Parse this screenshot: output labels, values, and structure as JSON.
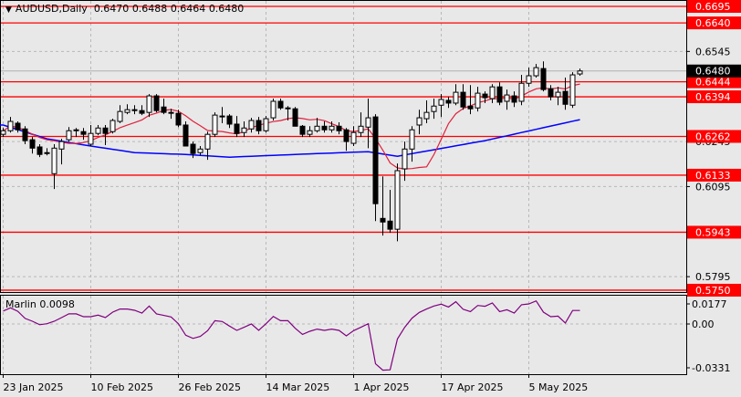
{
  "header": {
    "symbol": "AUDUSD,Daily",
    "open": "0.6470",
    "high": "0.6488",
    "low": "0.6464",
    "close": "0.6480"
  },
  "indicator": {
    "name": "Marlin",
    "value": "0.0098"
  },
  "colors": {
    "background": "#e8e8e8",
    "level": "#ff0000",
    "ma_fast": "#e0203c",
    "ma_slow": "#0000ff",
    "oscillator": "#800080",
    "bid_label": "#000000"
  },
  "chart_data": {
    "type": "candlestick",
    "symbol": "AUDUSD",
    "timeframe": "Daily",
    "ylim": [
      0.5733,
      0.6717
    ],
    "price_ticks": [
      "0.6545",
      "0.6245",
      "0.6095",
      "0.5795"
    ],
    "current_price": "0.6480",
    "levels": [
      "0.6695",
      "0.6640",
      "0.6444",
      "0.6394",
      "0.6262",
      "0.6133",
      "0.5943",
      "0.5750"
    ],
    "x_labels": [
      {
        "index": 0,
        "label": "23 Jan 2025"
      },
      {
        "index": 12,
        "label": "10 Feb 2025"
      },
      {
        "index": 24,
        "label": "26 Feb 2025"
      },
      {
        "index": 36,
        "label": "14 Mar 2025"
      },
      {
        "index": 48,
        "label": "1 Apr 2025"
      },
      {
        "index": 60,
        "label": "17 Apr 2025"
      },
      {
        "index": 72,
        "label": "5 May 2025"
      }
    ],
    "ohlc": [
      [
        0.6269,
        0.629,
        0.626,
        0.6281
      ],
      [
        0.6281,
        0.6327,
        0.6275,
        0.6312
      ],
      [
        0.6306,
        0.6312,
        0.6275,
        0.6284
      ],
      [
        0.6287,
        0.6296,
        0.6236,
        0.6248
      ],
      [
        0.6251,
        0.626,
        0.6205,
        0.6223
      ],
      [
        0.6227,
        0.6236,
        0.6193,
        0.6202
      ],
      [
        0.6208,
        0.6223,
        0.6199,
        0.6205
      ],
      [
        0.6138,
        0.6236,
        0.6087,
        0.6223
      ],
      [
        0.622,
        0.6254,
        0.6169,
        0.6245
      ],
      [
        0.6251,
        0.6293,
        0.6245,
        0.6281
      ],
      [
        0.6281,
        0.629,
        0.626,
        0.6284
      ],
      [
        0.6278,
        0.629,
        0.6251,
        0.6269
      ],
      [
        0.6236,
        0.63,
        0.623,
        0.6272
      ],
      [
        0.6272,
        0.63,
        0.6266,
        0.629
      ],
      [
        0.629,
        0.63,
        0.6233,
        0.6272
      ],
      [
        0.6278,
        0.6321,
        0.6272,
        0.6315
      ],
      [
        0.6312,
        0.6366,
        0.6306,
        0.6345
      ],
      [
        0.6342,
        0.6369,
        0.6336,
        0.6351
      ],
      [
        0.6348,
        0.6366,
        0.6336,
        0.6351
      ],
      [
        0.6348,
        0.6366,
        0.6333,
        0.6339
      ],
      [
        0.6342,
        0.6403,
        0.6327,
        0.6397
      ],
      [
        0.6397,
        0.6403,
        0.6342,
        0.6348
      ],
      [
        0.636,
        0.6388,
        0.6336,
        0.6342
      ],
      [
        0.6342,
        0.6354,
        0.6321,
        0.6339
      ],
      [
        0.6339,
        0.6351,
        0.6293,
        0.63
      ],
      [
        0.63,
        0.6312,
        0.623,
        0.623
      ],
      [
        0.6236,
        0.6245,
        0.619,
        0.6205
      ],
      [
        0.6208,
        0.623,
        0.6199,
        0.622
      ],
      [
        0.622,
        0.6278,
        0.6184,
        0.6269
      ],
      [
        0.6269,
        0.6342,
        0.626,
        0.6333
      ],
      [
        0.6327,
        0.636,
        0.6306,
        0.633
      ],
      [
        0.633,
        0.6336,
        0.629,
        0.6303
      ],
      [
        0.6303,
        0.633,
        0.626,
        0.6272
      ],
      [
        0.6275,
        0.6312,
        0.626,
        0.629
      ],
      [
        0.6287,
        0.6324,
        0.6275,
        0.6315
      ],
      [
        0.6315,
        0.6327,
        0.6269,
        0.6281
      ],
      [
        0.6281,
        0.633,
        0.6275,
        0.6321
      ],
      [
        0.6324,
        0.6388,
        0.6315,
        0.6379
      ],
      [
        0.6379,
        0.6388,
        0.6351,
        0.6357
      ],
      [
        0.6357,
        0.6363,
        0.6315,
        0.6354
      ],
      [
        0.6354,
        0.636,
        0.6296,
        0.6296
      ],
      [
        0.6296,
        0.63,
        0.626,
        0.6269
      ],
      [
        0.6269,
        0.6296,
        0.626,
        0.6281
      ],
      [
        0.6281,
        0.6324,
        0.6275,
        0.6296
      ],
      [
        0.6296,
        0.6312,
        0.6275,
        0.6284
      ],
      [
        0.6284,
        0.6312,
        0.6275,
        0.6296
      ],
      [
        0.6296,
        0.6309,
        0.6269,
        0.6281
      ],
      [
        0.6284,
        0.629,
        0.6214,
        0.6245
      ],
      [
        0.6239,
        0.6296,
        0.623,
        0.6275
      ],
      [
        0.6275,
        0.6342,
        0.626,
        0.6296
      ],
      [
        0.6293,
        0.6388,
        0.6223,
        0.6324
      ],
      [
        0.6327,
        0.6336,
        0.598,
        0.6038
      ],
      [
        0.5989,
        0.6129,
        0.5932,
        0.5977
      ],
      [
        0.598,
        0.6084,
        0.5941,
        0.5953
      ],
      [
        0.5953,
        0.6172,
        0.5913,
        0.6148
      ],
      [
        0.6154,
        0.6245,
        0.6114,
        0.622
      ],
      [
        0.622,
        0.6296,
        0.6178,
        0.6284
      ],
      [
        0.63,
        0.6351,
        0.6269,
        0.6324
      ],
      [
        0.6321,
        0.6382,
        0.6306,
        0.6342
      ],
      [
        0.6345,
        0.6388,
        0.6321,
        0.6363
      ],
      [
        0.6366,
        0.6403,
        0.6327,
        0.6385
      ],
      [
        0.6382,
        0.6394,
        0.6357,
        0.6373
      ],
      [
        0.6373,
        0.6436,
        0.6366,
        0.6409
      ],
      [
        0.6409,
        0.6436,
        0.6351,
        0.636
      ],
      [
        0.6363,
        0.6433,
        0.6336,
        0.6354
      ],
      [
        0.6357,
        0.6427,
        0.6345,
        0.6406
      ],
      [
        0.6403,
        0.6412,
        0.6373,
        0.6391
      ],
      [
        0.6388,
        0.6436,
        0.6373,
        0.6427
      ],
      [
        0.6427,
        0.6442,
        0.6366,
        0.6376
      ],
      [
        0.6379,
        0.6418,
        0.6351,
        0.64
      ],
      [
        0.6397,
        0.6412,
        0.636,
        0.6376
      ],
      [
        0.6379,
        0.6467,
        0.6366,
        0.6439
      ],
      [
        0.6439,
        0.6491,
        0.6427,
        0.6464
      ],
      [
        0.6464,
        0.6503,
        0.6458,
        0.6491
      ],
      [
        0.6488,
        0.6512,
        0.6412,
        0.6418
      ],
      [
        0.6421,
        0.6433,
        0.6382,
        0.6394
      ],
      [
        0.6394,
        0.6427,
        0.6366,
        0.6409
      ],
      [
        0.6412,
        0.6458,
        0.6351,
        0.6369
      ],
      [
        0.6366,
        0.6476,
        0.6357,
        0.6467
      ],
      [
        0.647,
        0.6488,
        0.6464,
        0.648
      ]
    ],
    "ma_slow": [
      {
        "index": 0,
        "value": 0.63
      },
      {
        "index": 6,
        "value": 0.6254
      },
      {
        "index": 12,
        "value": 0.623
      },
      {
        "index": 18,
        "value": 0.6208
      },
      {
        "index": 25,
        "value": 0.6202
      },
      {
        "index": 31,
        "value": 0.6193
      },
      {
        "index": 37,
        "value": 0.6199
      },
      {
        "index": 43,
        "value": 0.6205
      },
      {
        "index": 50,
        "value": 0.6211
      },
      {
        "index": 54,
        "value": 0.6196
      },
      {
        "index": 66,
        "value": 0.6248
      },
      {
        "index": 79,
        "value": 0.6318
      }
    ],
    "oscillator": {
      "name": "Marlin",
      "ticks": [
        "0.0177",
        "0.00",
        "-0.0331"
      ],
      "values": [
        0.0094,
        0.0117,
        0.0092,
        0.004,
        0.002,
        -0.0005,
        0.0002,
        0.002,
        0.0046,
        0.0073,
        0.0073,
        0.0053,
        0.0053,
        0.0064,
        0.0046,
        0.0086,
        0.0108,
        0.0108,
        0.0099,
        0.0079,
        0.013,
        0.0073,
        0.0062,
        0.0051,
        0.0002,
        -0.0081,
        -0.0104,
        -0.009,
        -0.0048,
        0.0024,
        0.0018,
        -0.0015,
        -0.0046,
        -0.0024,
        0.0,
        -0.0046,
        0.0002,
        0.0055,
        0.0024,
        0.0024,
        -0.0031,
        -0.0075,
        -0.0053,
        -0.0037,
        -0.0046,
        -0.0037,
        -0.0046,
        -0.0086,
        -0.0048,
        -0.0024,
        0.0002,
        -0.0288,
        -0.0334,
        -0.0331,
        -0.0108,
        -0.0024,
        0.0042,
        0.0084,
        0.0108,
        0.013,
        0.0143,
        0.0123,
        0.0161,
        0.0106,
        0.009,
        0.0134,
        0.0128,
        0.0152,
        0.009,
        0.0103,
        0.0079,
        0.0139,
        0.0145,
        0.0167,
        0.0086,
        0.0053,
        0.0057,
        0.0007,
        0.0098,
        0.0098
      ]
    }
  }
}
